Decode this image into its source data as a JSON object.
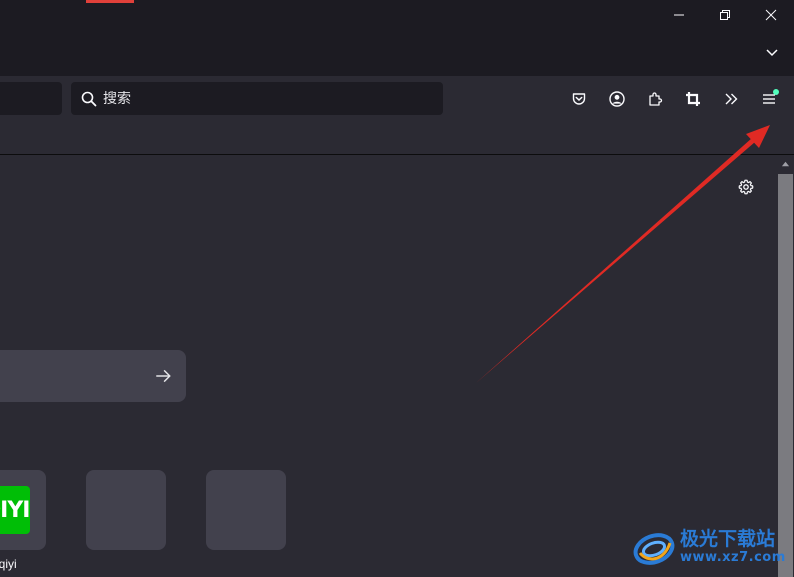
{
  "window": {
    "buttons": [
      {
        "name": "minimize-button",
        "icon": "minimize-icon"
      },
      {
        "name": "restore-button",
        "icon": "restore-icon"
      },
      {
        "name": "close-window-button",
        "icon": "close-icon"
      }
    ],
    "list_tabs_icon": "chevron-down-icon"
  },
  "navbar": {
    "search_placeholder": "搜索",
    "toolbar": [
      {
        "name": "pocket-button",
        "icon": "pocket-icon"
      },
      {
        "name": "account-button",
        "icon": "account-icon"
      },
      {
        "name": "extensions-button",
        "icon": "puzzle-icon"
      },
      {
        "name": "screenshot-button",
        "icon": "crop-icon"
      },
      {
        "name": "overflow-menu-button",
        "icon": "double-chevron-right-icon"
      },
      {
        "name": "app-menu-button",
        "icon": "hamburger-menu-icon",
        "badge_color": "#54ffbd"
      }
    ]
  },
  "newtab": {
    "settings_icon": "gear-icon",
    "search_go_icon": "arrow-right-icon",
    "shortcuts": [
      {
        "label": "iqiyi",
        "logo_text": "QIYI",
        "logo_color": "#00be06"
      },
      {
        "label": "",
        "logo_text": ""
      },
      {
        "label": "",
        "logo_text": ""
      }
    ]
  },
  "annotation": {
    "arrow_color": "#e02a24"
  },
  "watermark": {
    "title": "极光下载站",
    "url": "www.xz7.com"
  },
  "colors": {
    "titlebar": "#1c1b22",
    "toolbar": "#2b2a33",
    "field": "#1c1b22",
    "tile": "#42414d",
    "accent_tab": "#e0403a"
  }
}
